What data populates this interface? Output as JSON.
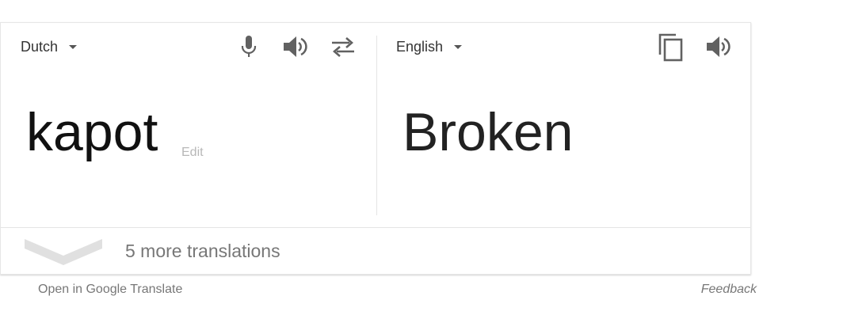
{
  "source": {
    "language": "Dutch",
    "text": "kapot",
    "edit_label": "Edit"
  },
  "target": {
    "language": "English",
    "text": "Broken"
  },
  "icons": {
    "mic": "microphone-icon",
    "source_speaker": "speaker-icon",
    "swap": "swap-languages-icon",
    "copy": "copy-icon",
    "target_speaker": "speaker-icon"
  },
  "more_translations": {
    "label": "5 more translations"
  },
  "footer": {
    "open_link": "Open in Google Translate",
    "feedback": "Feedback"
  },
  "colors": {
    "icon": "#616161",
    "muted_text": "#777777",
    "edit_text": "#b8b8b8",
    "chevron": "#e0e0e0"
  }
}
